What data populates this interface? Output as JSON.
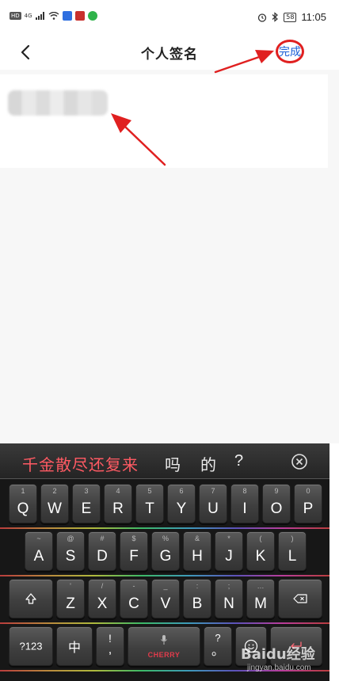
{
  "status_bar": {
    "left_badges": [
      "HD",
      "4G"
    ],
    "battery": "58",
    "time": "11:05"
  },
  "nav": {
    "title": "个人签名",
    "done_label": "完成"
  },
  "keyboard": {
    "candidates": {
      "primary": "千金散尽还复来",
      "others": [
        "吗",
        "的",
        "?"
      ]
    },
    "row1": [
      {
        "sub": "1",
        "key": "Q"
      },
      {
        "sub": "2",
        "key": "W"
      },
      {
        "sub": "3",
        "key": "E"
      },
      {
        "sub": "4",
        "key": "R"
      },
      {
        "sub": "5",
        "key": "T"
      },
      {
        "sub": "6",
        "key": "Y"
      },
      {
        "sub": "7",
        "key": "U"
      },
      {
        "sub": "8",
        "key": "I"
      },
      {
        "sub": "9",
        "key": "O"
      },
      {
        "sub": "0",
        "key": "P"
      }
    ],
    "row2": [
      {
        "sub": "~",
        "key": "A"
      },
      {
        "sub": "@",
        "key": "S"
      },
      {
        "sub": "#",
        "key": "D"
      },
      {
        "sub": "$",
        "key": "F"
      },
      {
        "sub": "%",
        "key": "G"
      },
      {
        "sub": "&",
        "key": "H"
      },
      {
        "sub": "*",
        "key": "J"
      },
      {
        "sub": "(",
        "key": "K"
      },
      {
        "sub": ")",
        "key": "L"
      }
    ],
    "row3": [
      {
        "sub": "'",
        "key": "Z"
      },
      {
        "sub": "/",
        "key": "X"
      },
      {
        "sub": "-",
        "key": "C"
      },
      {
        "sub": "_",
        "key": "V"
      },
      {
        "sub": ":",
        "key": "B"
      },
      {
        "sub": ";",
        "key": "N"
      },
      {
        "sub": "…",
        "key": "M"
      }
    ],
    "num_key": "?123",
    "zh_key": "中",
    "punct_top": "!",
    "punct_bottom": ",",
    "space_brand": "CHERRY",
    "q_top": "?",
    "q_bottom": "。"
  },
  "watermark": {
    "brand": "Baidu经验",
    "url": "jingyan.baidu.com"
  },
  "colors": {
    "accent_blue": "#1a5fd6",
    "annotation_red": "#e02020",
    "candidate_red": "#ff5a63"
  }
}
